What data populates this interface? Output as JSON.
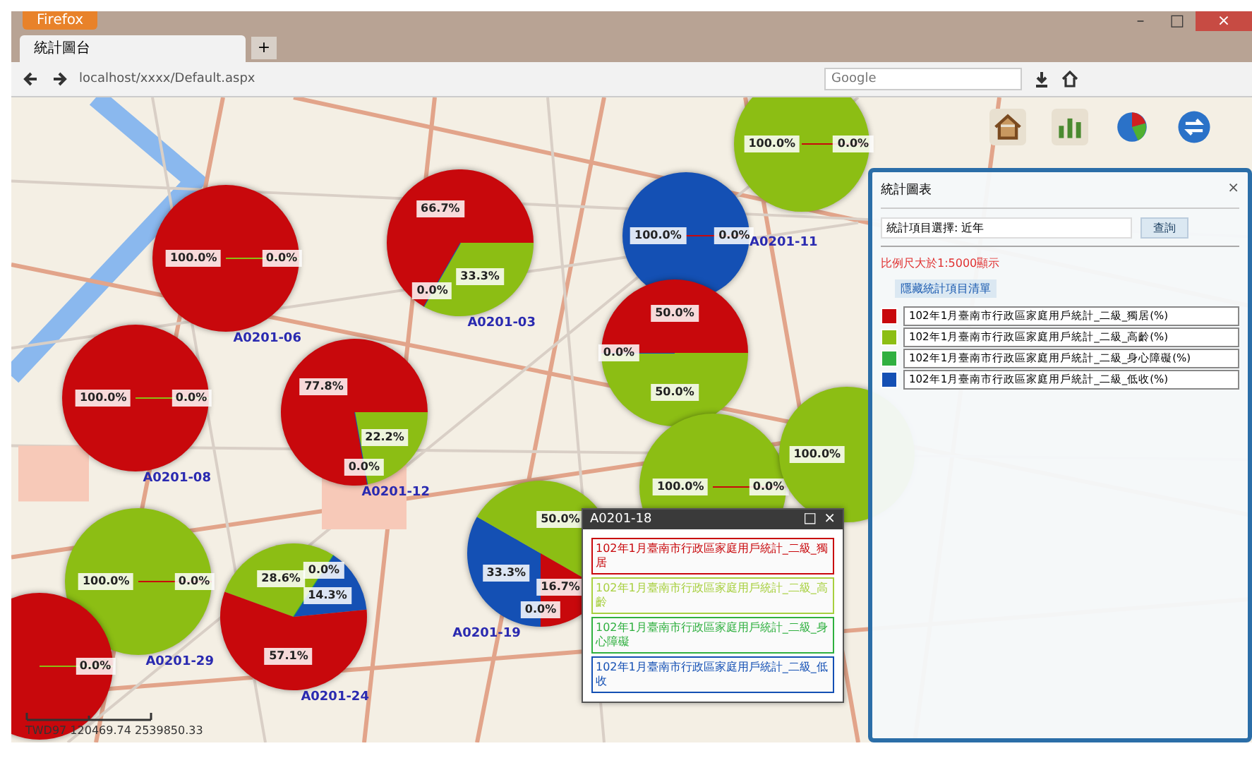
{
  "browser": {
    "menu_button": "Firefox",
    "window_controls": [
      "–",
      "□",
      "×"
    ],
    "tab": "統計圖台",
    "new_tab": "+",
    "url": "localhost/xxxx/Default.aspx",
    "search_placeholder": "Google"
  },
  "map": {
    "pies": [
      {
        "label": "A0201-06",
        "chart_data": {
          "type": "pie",
          "values": [
            100,
            0
          ],
          "colors": [
            "#c8080c",
            "#8cbe14"
          ],
          "value_labels": [
            "100.0%",
            "0.0%"
          ]
        }
      },
      {
        "label": "A0201-03",
        "chart_data": {
          "type": "pie",
          "values": [
            33.3,
            0,
            66.7
          ],
          "colors": [
            "#8cbe14",
            "#1450b4",
            "#c8080c"
          ],
          "value_labels": [
            "33.3%",
            "0.0%",
            "66.7%"
          ]
        }
      },
      {
        "label": "A0201-11",
        "chart_data": {
          "type": "pie",
          "values": [
            100,
            0
          ],
          "colors": [
            "#1450b4",
            "#c8080c"
          ],
          "value_labels": [
            "100.0%",
            "0.0%"
          ]
        }
      },
      {
        "chart_data": {
          "type": "pie",
          "values": [
            100,
            0
          ],
          "colors": [
            "#8cbe14",
            "#c8080c"
          ],
          "value_labels": [
            "100.0%",
            "0.0%"
          ]
        }
      },
      {
        "label": "A0201-08",
        "chart_data": {
          "type": "pie",
          "values": [
            100,
            0
          ],
          "colors": [
            "#c8080c",
            "#8cbe14"
          ],
          "value_labels": [
            "100.0%",
            "0.0%"
          ]
        }
      },
      {
        "label": "A0201-12",
        "chart_data": {
          "type": "pie",
          "values": [
            22.2,
            0,
            77.8
          ],
          "colors": [
            "#8cbe14",
            "#1450b4",
            "#c8080c"
          ],
          "value_labels": [
            "22.2%",
            "0.0%",
            "77.8%"
          ]
        }
      },
      {
        "chart_data": {
          "type": "pie",
          "values": [
            50,
            0,
            50
          ],
          "colors": [
            "#8cbe14",
            "#1450b4",
            "#c8080c"
          ],
          "value_labels": [
            "50.0%",
            "0.0%",
            "50.0%"
          ]
        }
      },
      {
        "chart_data": {
          "type": "pie",
          "values": [
            100,
            0
          ],
          "colors": [
            "#8cbe14",
            "#c8080c"
          ],
          "value_labels": [
            "100.0%",
            "0.0%"
          ]
        }
      },
      {
        "chart_data": {
          "type": "pie",
          "values": [
            100
          ],
          "colors": [
            "#8cbe14"
          ],
          "value_labels": [
            "100.0%"
          ]
        }
      },
      {
        "label": "A0201-29",
        "chart_data": {
          "type": "pie",
          "values": [
            100,
            0
          ],
          "colors": [
            "#8cbe14",
            "#c8080c"
          ],
          "value_labels": [
            "100.0%",
            "0.0%"
          ]
        }
      },
      {
        "label": "A0201-24",
        "chart_data": {
          "type": "pie",
          "values": [
            28.6,
            0,
            14.3,
            57.1
          ],
          "colors": [
            "#8cbe14",
            "#30b040",
            "#1450b4",
            "#c8080c"
          ],
          "value_labels": [
            "28.6%",
            "0.0%",
            "14.3%",
            "57.1%"
          ]
        }
      },
      {
        "label": "A0201-19",
        "chart_data": {
          "type": "pie",
          "values": [
            0,
            33.3,
            50,
            16.7
          ],
          "colors": [
            "#30b040",
            "#1450b4",
            "#8cbe14",
            "#c8080c"
          ],
          "value_labels": [
            "0.0%",
            "33.3%",
            "50.0%",
            "16.7%"
          ]
        }
      },
      {
        "chart_data": {
          "type": "pie",
          "values": [
            100,
            0
          ],
          "colors": [
            "#c8080c",
            "#8cbe14"
          ],
          "value_labels": [
            null,
            "0.0%"
          ]
        }
      }
    ],
    "coordinates": "TWD97 120469.74 2539850.33"
  },
  "popup": {
    "title": "A0201-18",
    "controls": [
      "□",
      "×"
    ],
    "items": [
      {
        "text": "102年1月臺南市行政區家庭用戶統計_二級_獨居",
        "color": "#c8080c"
      },
      {
        "text": "102年1月臺南市行政區家庭用戶統計_二級_高齡",
        "color": "#a8d040"
      },
      {
        "text": "102年1月臺南市行政區家庭用戶統計_二級_身心障礙",
        "color": "#30b040"
      },
      {
        "text": "102年1月臺南市行政區家庭用戶統計_二級_低收",
        "color": "#1450b4"
      }
    ]
  },
  "panel": {
    "title": "統計圖表",
    "close": "×",
    "field_value": "統計項目選擇: 近年",
    "query_button": "查詢",
    "notice": "比例尺大於1:5000顯示",
    "toggle_link": "隱藏統計項目清單",
    "legend": [
      {
        "text": "102年1月臺南市行政區家庭用戶統計_二級_獨居(%)",
        "color": "#c8080c"
      },
      {
        "text": "102年1月臺南市行政區家庭用戶統計_二級_高齡(%)",
        "color": "#8cbe14"
      },
      {
        "text": "102年1月臺南市行政區家庭用戶統計_二級_身心障礙(%)",
        "color": "#30b040"
      },
      {
        "text": "102年1月臺南市行政區家庭用戶統計_二級_低收(%)",
        "color": "#1450b4"
      }
    ]
  }
}
